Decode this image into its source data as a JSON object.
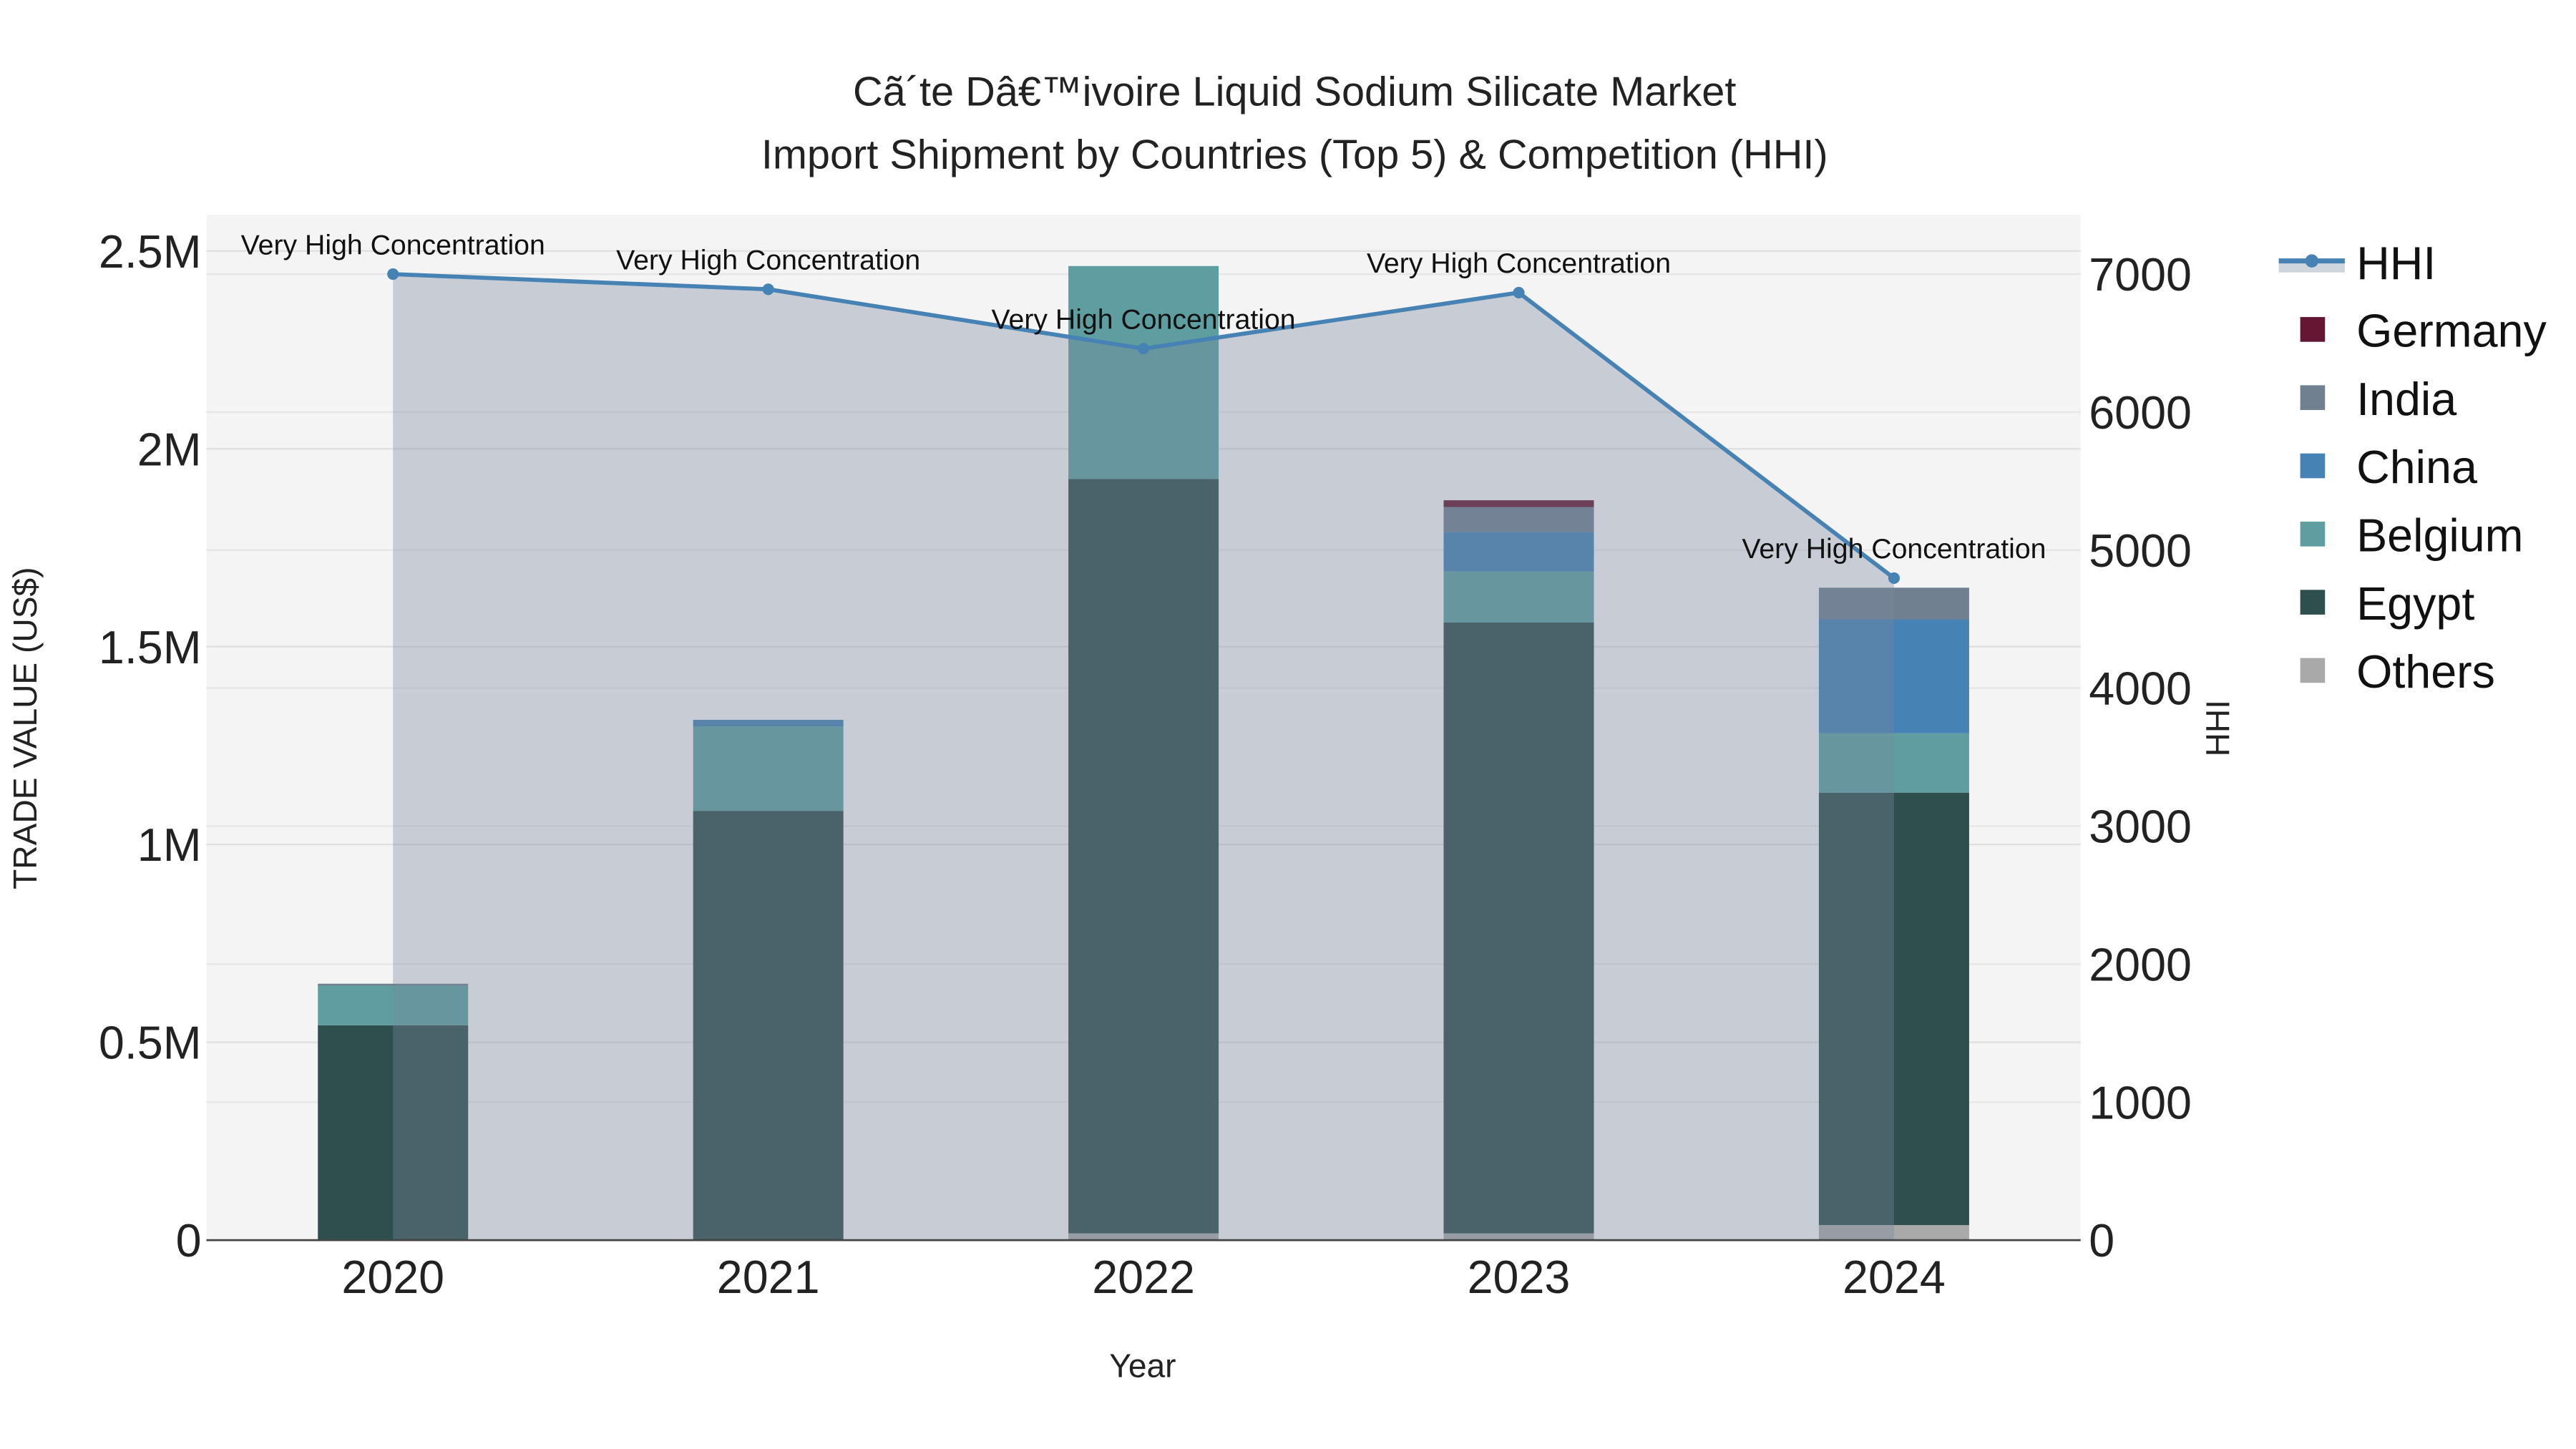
{
  "chart_data": {
    "type": "bar",
    "title_line1": "Cã´te Dâ€™ivoire Liquid Sodium Silicate Market",
    "title_line2": "Import Shipment by Countries (Top 5) & Competition (HHI)",
    "xlabel": "Year",
    "ylabel": "TRADE VALUE (US$)",
    "y2label": "HHI",
    "categories": [
      "2020",
      "2021",
      "2022",
      "2023",
      "2024"
    ],
    "ylim": [
      0,
      2500000
    ],
    "y2lim": [
      0,
      7000
    ],
    "yticks": [
      {
        "v": 0,
        "label": "0"
      },
      {
        "v": 500000,
        "label": "0.5M"
      },
      {
        "v": 1000000,
        "label": "1M"
      },
      {
        "v": 1500000,
        "label": "1.5M"
      },
      {
        "v": 2000000,
        "label": "2M"
      },
      {
        "v": 2500000,
        "label": "2.5M"
      }
    ],
    "y2ticks": [
      0,
      1000,
      2000,
      3000,
      4000,
      5000,
      6000,
      7000
    ],
    "stack_order": [
      "Others",
      "Egypt",
      "Belgium",
      "China",
      "India",
      "Germany"
    ],
    "series": [
      {
        "name": "Germany",
        "color": "#641633",
        "values": [
          0,
          0,
          0,
          17000,
          0
        ]
      },
      {
        "name": "India",
        "color": "#708090",
        "values": [
          5000,
          0,
          0,
          63000,
          80000
        ]
      },
      {
        "name": "China",
        "color": "#4682B4",
        "values": [
          0,
          17000,
          0,
          100000,
          288000
        ]
      },
      {
        "name": "Belgium",
        "color": "#5F9EA0",
        "values": [
          100000,
          213000,
          538000,
          129000,
          150000
        ]
      },
      {
        "name": "Egypt",
        "color": "#2F4F4F",
        "values": [
          543000,
          1085000,
          1907000,
          1544000,
          1093000
        ]
      },
      {
        "name": "Others",
        "color": "#A9A9A9",
        "values": [
          0,
          0,
          17000,
          17000,
          38000
        ]
      }
    ],
    "hhi": {
      "name": "HHI",
      "color": "#4682B4",
      "values": [
        7000,
        6890,
        6460,
        6866,
        4797
      ]
    },
    "annotations": [
      "Very High Concentration",
      "Very High Concentration",
      "Very High Concentration",
      "Very High Concentration",
      "Very High Concentration"
    ],
    "legend_placement": "right",
    "grid": true
  }
}
